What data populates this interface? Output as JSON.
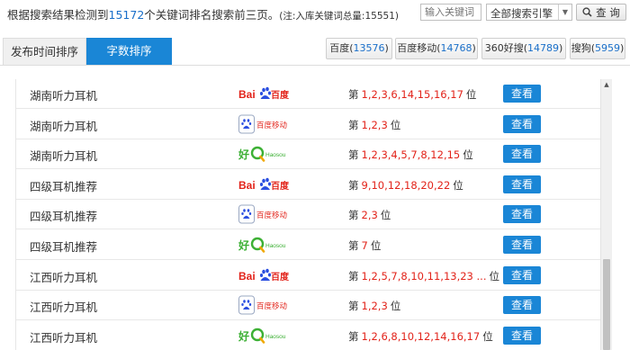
{
  "header": {
    "summary_prefix": "根据搜索结果检测到",
    "keyword_count": "15172",
    "summary_suffix": "个关键词排名搜索前三页。",
    "note": "(注:入库关键词总量:15551)"
  },
  "search": {
    "placeholder": "输入关键词",
    "engine_selected": "全部搜索引擎",
    "query_label": "查 询"
  },
  "tabs": [
    {
      "label": "发布时间排序",
      "active": false
    },
    {
      "label": "字数排序",
      "active": true
    }
  ],
  "engines": [
    {
      "name": "百度",
      "count": "13576"
    },
    {
      "name": "百度移动",
      "count": "14768"
    },
    {
      "name": "360好搜",
      "count": "14789"
    },
    {
      "name": "搜狗",
      "count": "5959"
    }
  ],
  "rank_prefix": "第",
  "rank_suffix": "位",
  "view_label": "查看",
  "logos": {
    "baidu_text": "Bai",
    "baidu_cn": "百度",
    "baidu_mobile_text": "百度移动",
    "haosou_cn": "好",
    "haosou_en": "Haosou"
  },
  "rows": [
    {
      "keyword": "湖南听力耳机",
      "engine": "baidu",
      "positions": "1,2,3,6,14,15,16,17"
    },
    {
      "keyword": "湖南听力耳机",
      "engine": "baidu-mobile",
      "positions": "1,2,3"
    },
    {
      "keyword": "湖南听力耳机",
      "engine": "haosou",
      "positions": "1,2,3,4,5,7,8,12,15"
    },
    {
      "keyword": "四级耳机推荐",
      "engine": "baidu",
      "positions": "9,10,12,18,20,22"
    },
    {
      "keyword": "四级耳机推荐",
      "engine": "baidu-mobile",
      "positions": "2,3"
    },
    {
      "keyword": "四级耳机推荐",
      "engine": "haosou",
      "positions": "7"
    },
    {
      "keyword": "江西听力耳机",
      "engine": "baidu",
      "positions": "1,2,5,7,8,10,11,13,23 ..."
    },
    {
      "keyword": "江西听力耳机",
      "engine": "baidu-mobile",
      "positions": "1,2,3"
    },
    {
      "keyword": "江西听力耳机",
      "engine": "haosou",
      "positions": "1,2,6,8,10,12,14,16,17"
    }
  ],
  "colors": {
    "accent": "#1a86d6",
    "rank": "#e2231a",
    "count": "#1a6fc9",
    "haosou_green": "#3cb034"
  },
  "icons": {
    "query": "search-icon",
    "dropdown": "chevron-down-icon",
    "baidu": "baidu-paw-logo",
    "haosou": "haosou-logo"
  }
}
